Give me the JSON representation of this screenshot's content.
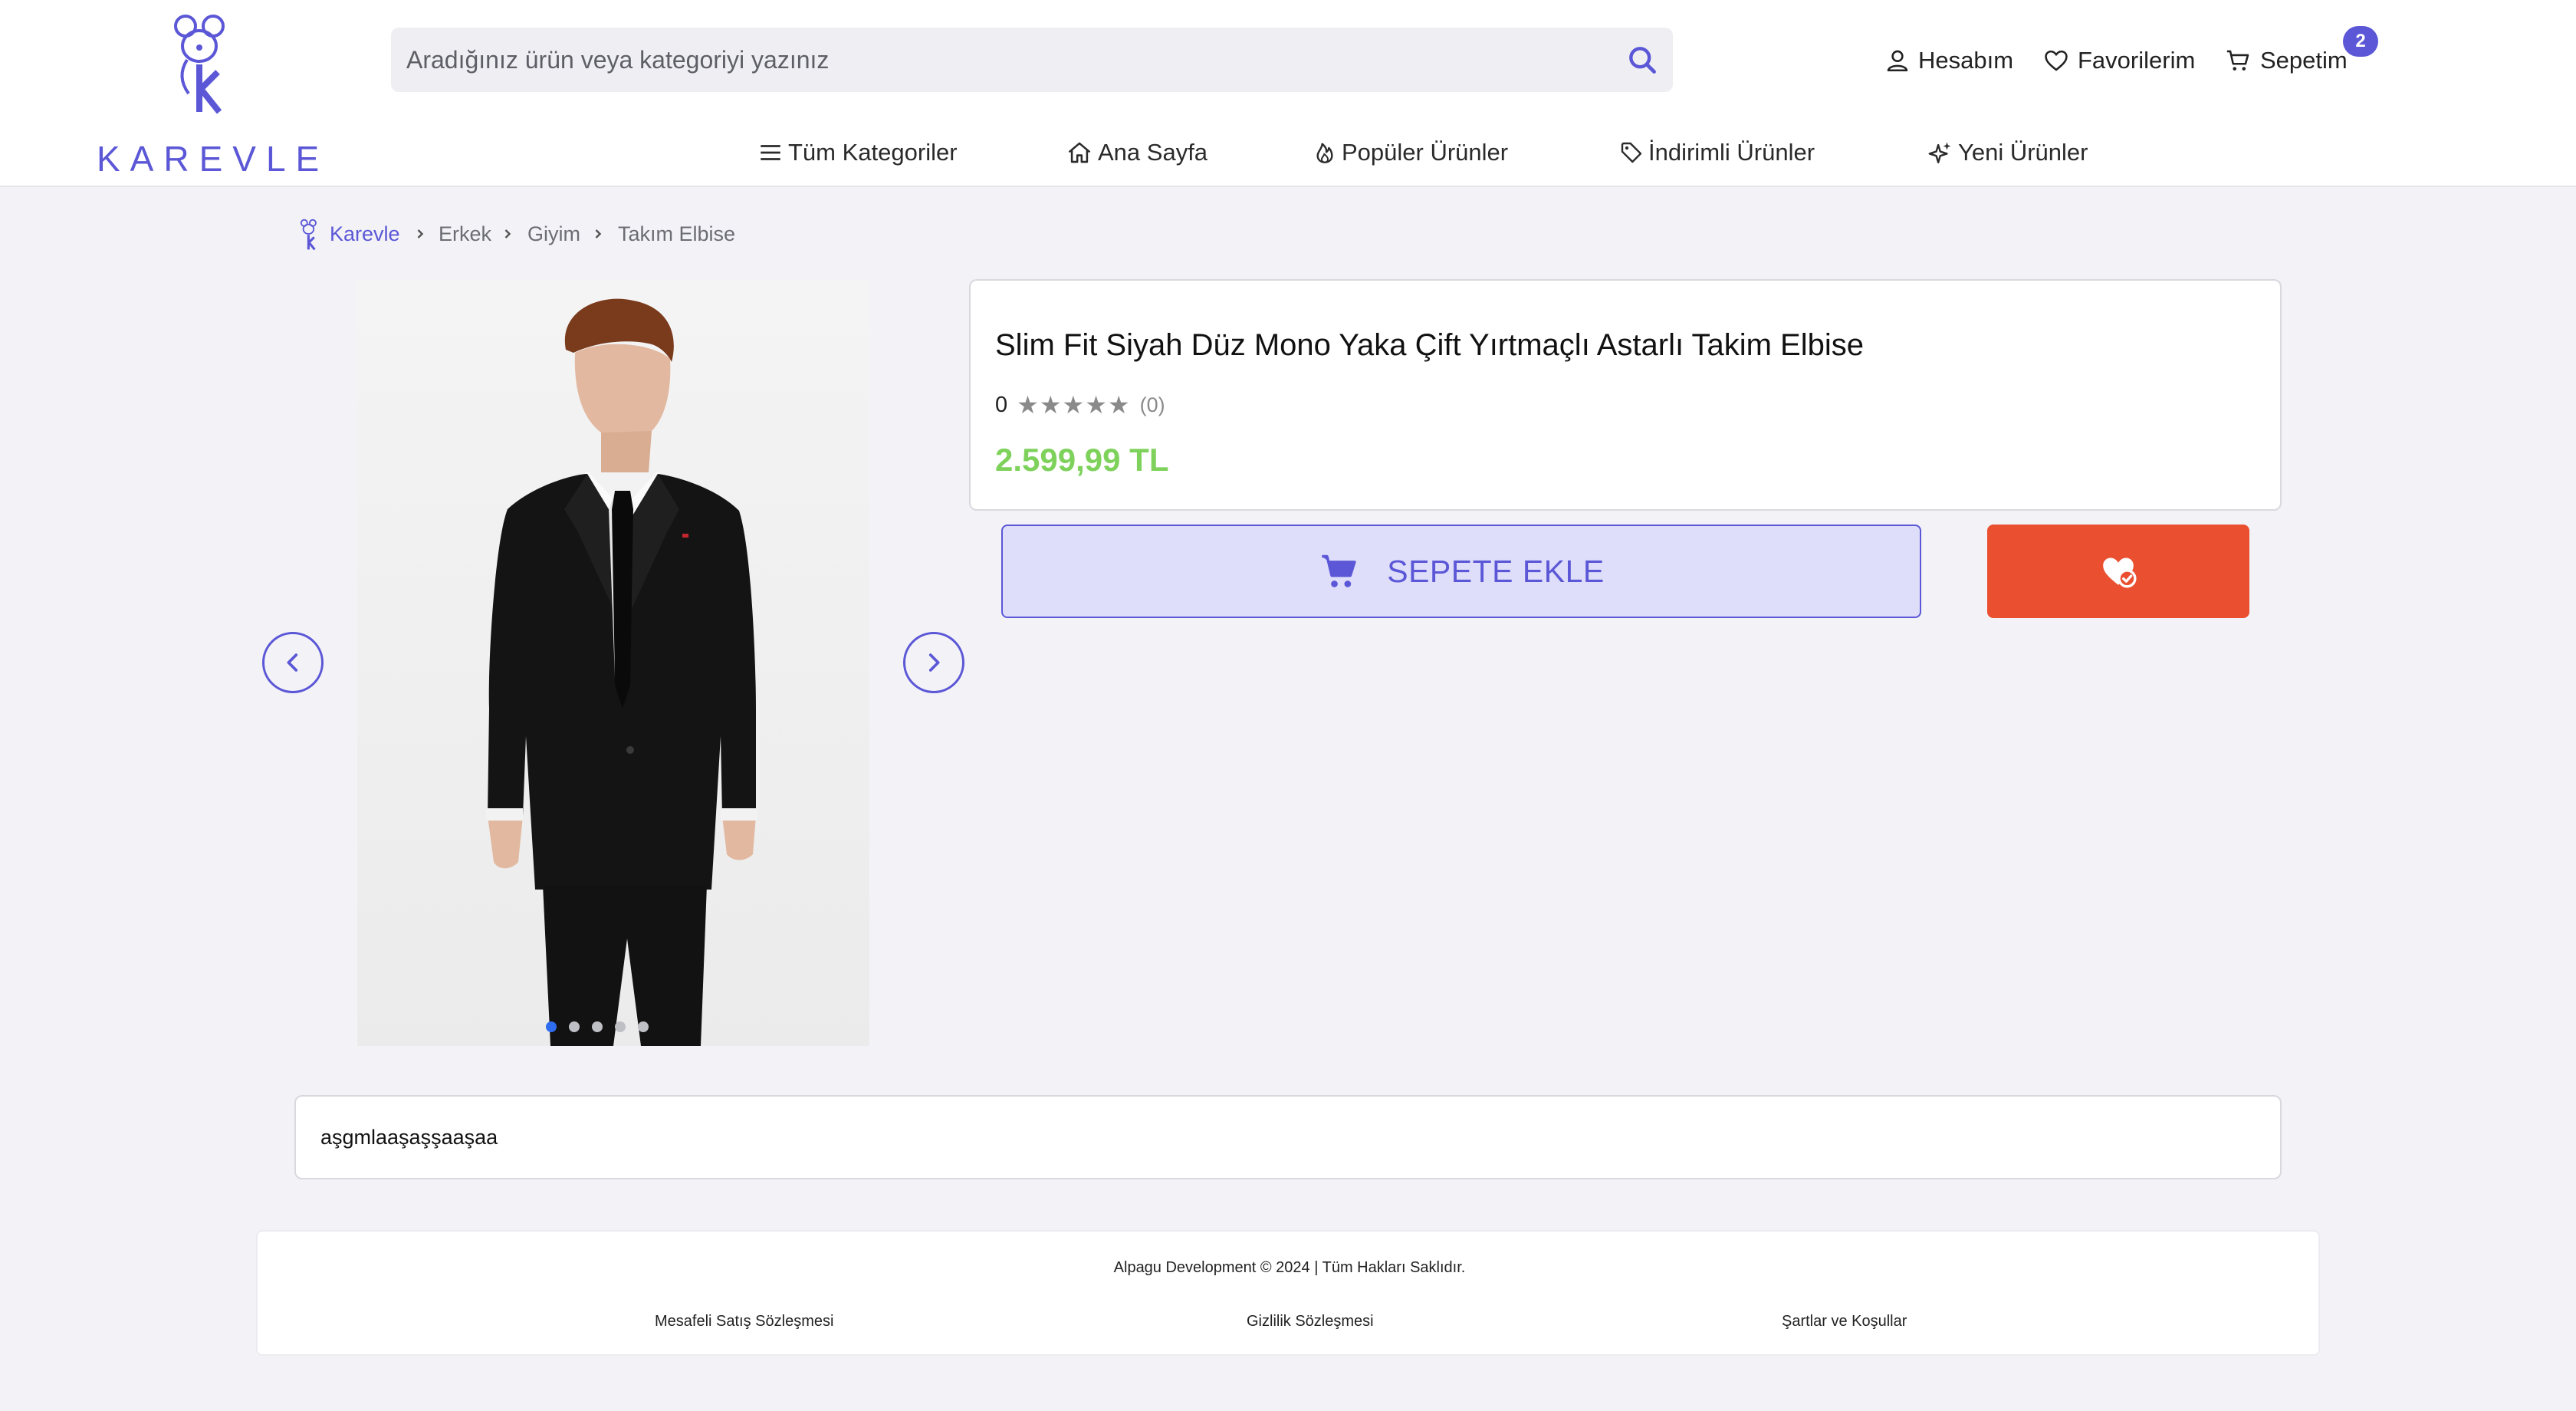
{
  "header": {
    "logo_text": "KAREVLE",
    "search_placeholder": "Aradığınız ürün veya kategoriyi yazınız",
    "account_label": "Hesabım",
    "favorites_label": "Favorilerim",
    "cart_label": "Sepetim",
    "cart_count": "2",
    "brand_color": "#5b57d6"
  },
  "nav": {
    "items": [
      {
        "label": "Tüm Kategoriler",
        "icon": "menu-icon"
      },
      {
        "label": "Ana Sayfa",
        "icon": "home-icon"
      },
      {
        "label": "Popüler Ürünler",
        "icon": "flame-icon"
      },
      {
        "label": "İndirimli Ürünler",
        "icon": "tag-icon"
      },
      {
        "label": "Yeni Ürünler",
        "icon": "sparkle-icon"
      }
    ]
  },
  "breadcrumb": {
    "items": [
      "Karevle",
      "Erkek",
      "Giyim",
      "Takım Elbise"
    ]
  },
  "gallery": {
    "image_count": 5,
    "active_index": 0
  },
  "product": {
    "title": "Slim Fit Siyah Düz Mono Yaka Çift Yırtmaçlı Astarlı Takim Elbise",
    "rating_value": "0",
    "stars": "★★★★★",
    "review_count": "(0)",
    "price": "2.599,99 TL",
    "price_color": "#7ed25c",
    "add_to_cart_label": "SEPETE EKLE",
    "favorite_button_color": "#ea4f30",
    "description": "aşgmlaaşaşşaaşaa"
  },
  "footer": {
    "copyright": "Alpagu Development © 2024 | Tüm Hakları Saklıdır.",
    "links": [
      "Mesafeli Satış Sözleşmesi",
      "Gizlilik Sözleşmesi",
      "Şartlar ve Koşullar"
    ]
  }
}
